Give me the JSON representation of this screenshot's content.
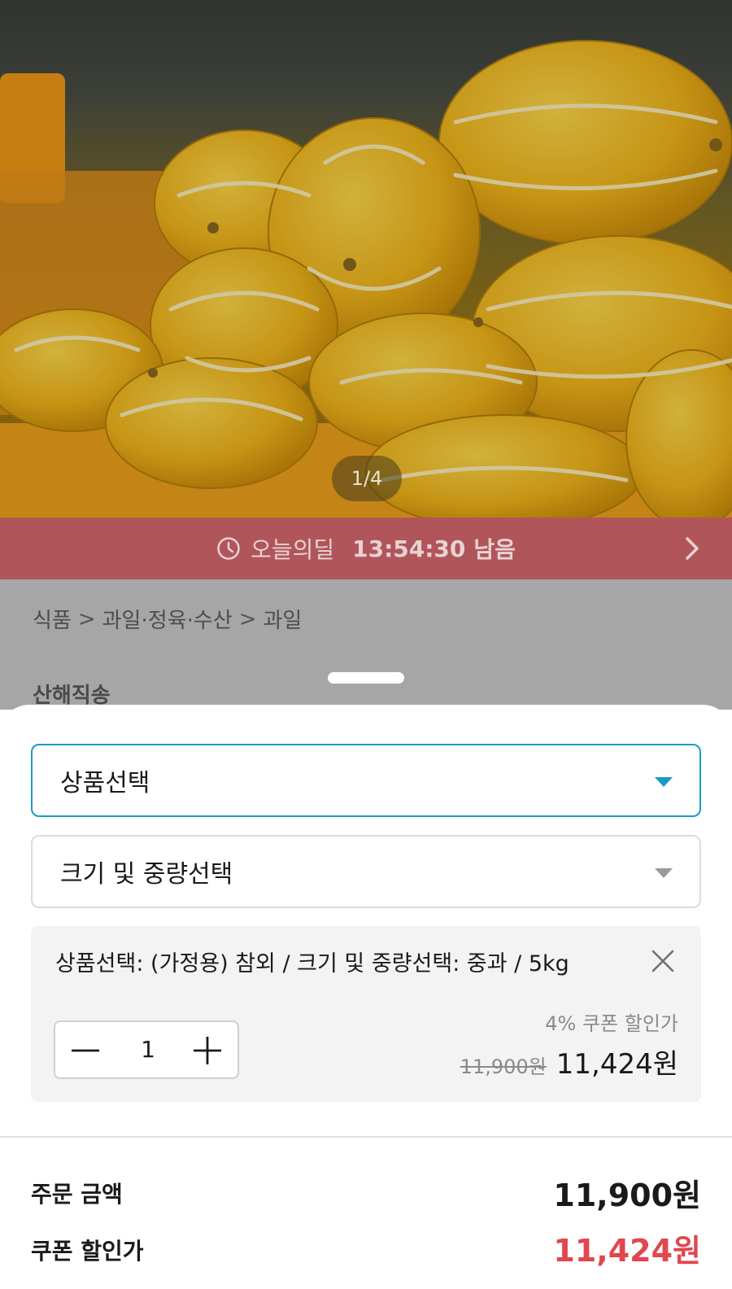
{
  "gallery": {
    "indicator": "1/4"
  },
  "deal": {
    "label": "오늘의딜",
    "countdown": "13:54:30",
    "suffix": "남음",
    "icon": "clock-icon",
    "accent": "#b0565b"
  },
  "breadcrumb": {
    "items": [
      "식품",
      "과일·정육·수산",
      "과일"
    ]
  },
  "seller": "산해직송",
  "sheet": {
    "product_select": {
      "placeholder": "상품선택"
    },
    "size_select": {
      "placeholder": "크기 및 중량선택"
    },
    "selected_option": {
      "text": "상품선택: (가정용) 참외 / 크기 및 중량선택: 중과 / 5kg",
      "quantity": "1",
      "coupon_label": "4% 쿠폰 할인가",
      "original_price": "11,900원",
      "discounted_price": "11,424원"
    },
    "summary": {
      "order_amount_label": "주문 금액",
      "order_amount": "11,900원",
      "coupon_price_label": "쿠폰 할인가",
      "coupon_price": "11,424원"
    }
  },
  "colors": {
    "accent_blue": "#1a9bc6",
    "sale_red": "#e0474e"
  }
}
